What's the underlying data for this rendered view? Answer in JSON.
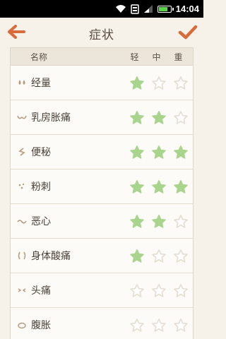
{
  "status_bar": {
    "time": "14:04",
    "icons": [
      "wifi-icon",
      "notification-icon",
      "signal-icon",
      "battery-icon"
    ]
  },
  "header": {
    "title": "症状",
    "back_icon": "back-arrow-icon",
    "confirm_icon": "checkmark-icon"
  },
  "table": {
    "columns": {
      "name": "名称",
      "mild": "轻",
      "medium": "中",
      "severe": "重"
    },
    "rows": [
      {
        "label": "经量",
        "icon": "drops-icon",
        "level": 1
      },
      {
        "label": "乳房胀痛",
        "icon": "bra-icon",
        "level": 2
      },
      {
        "label": "便秘",
        "icon": "constipation-icon",
        "level": 3
      },
      {
        "label": "粉刺",
        "icon": "acne-icon",
        "level": 3
      },
      {
        "label": "恶心",
        "icon": "nausea-icon",
        "level": 2
      },
      {
        "label": "身体酸痛",
        "icon": "body-ache-icon",
        "level": 1
      },
      {
        "label": "头痛",
        "icon": "headache-icon",
        "level": 0
      },
      {
        "label": "腹胀",
        "icon": "bloating-icon",
        "level": 0
      }
    ]
  },
  "colors": {
    "accent": "#d96a3a",
    "star_filled": "#a9d48d",
    "star_empty": "#e3ddd2",
    "background": "#f6f2ea"
  }
}
